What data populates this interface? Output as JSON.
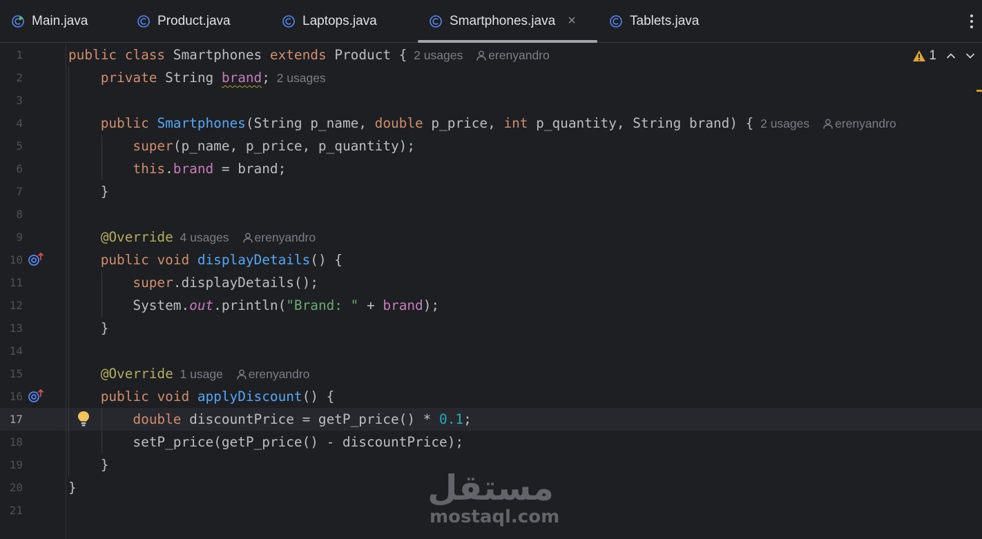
{
  "tabs": [
    {
      "label": "Main.java",
      "active": false
    },
    {
      "label": "Product.java",
      "active": false
    },
    {
      "label": "Laptops.java",
      "active": false
    },
    {
      "label": "Smartphones.java",
      "active": true
    },
    {
      "label": "Tablets.java",
      "active": false
    }
  ],
  "close_symbol": "×",
  "inspections": {
    "warnings": "1"
  },
  "line_numbers": [
    "1",
    "2",
    "3",
    "4",
    "5",
    "6",
    "7",
    "8",
    "9",
    "10",
    "11",
    "12",
    "13",
    "14",
    "15",
    "16",
    "17",
    "18",
    "19",
    "20",
    "21"
  ],
  "current_line": 17,
  "code": {
    "l1": [
      "public",
      "class",
      "Smartphones",
      "extends",
      "Product",
      "{"
    ],
    "l2": [
      "private",
      "String",
      "brand",
      ";"
    ],
    "l4": [
      "public",
      "Smartphones",
      "(String p_name, ",
      "double",
      " p_price, ",
      "int",
      " p_quantity, String brand) {"
    ],
    "l5": [
      "super",
      "(p_name, p_price, p_quantity);"
    ],
    "l6": [
      "this",
      ".",
      "brand",
      " = brand;"
    ],
    "l7": "}",
    "l9": "@Override",
    "l10": [
      "public",
      "void",
      "displayDetails",
      "() {"
    ],
    "l11": [
      "super",
      ".displayDetails();"
    ],
    "l12": [
      "System.",
      "out",
      ".println(",
      "\"Brand: \"",
      " + ",
      "brand",
      ");"
    ],
    "l13": "}",
    "l15": "@Override",
    "l16": [
      "public",
      "void",
      "applyDiscount",
      "() {"
    ],
    "l17": [
      "double",
      " discountPrice = getP_price() * ",
      "0.1",
      ";"
    ],
    "l18": "setP_price(getP_price() - discountPrice);",
    "l19": "}",
    "l20": "}"
  },
  "hints": {
    "l1_usages": "2 usages",
    "l1_author": "erenyandro",
    "l2_usages": "2 usages",
    "l4_usages": "2 usages",
    "l4_author": "erenyandro",
    "l9_usages": "4 usages",
    "l9_author": "erenyandro",
    "l15_usages": "1 usage",
    "l15_author": "erenyandro"
  },
  "watermark": {
    "arabic": "مستقل",
    "latin": "mostaql.com"
  },
  "colors": {
    "background": "#1e1f22",
    "keyword": "#cf8e6d",
    "function": "#56a8f5",
    "field": "#c77dbb",
    "annotation": "#b3ae60",
    "string": "#6aab73",
    "number": "#2aacb8",
    "warning": "#d59e2c"
  }
}
